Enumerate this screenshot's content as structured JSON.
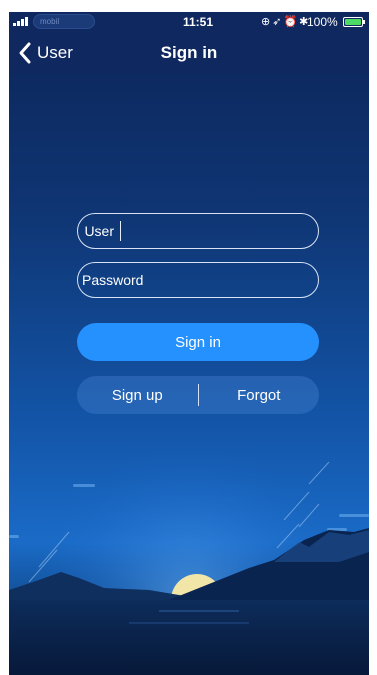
{
  "status_bar": {
    "carrier": "mobil",
    "time": "11:51",
    "battery_percent": "100%",
    "battery_level": 1.0,
    "icons": [
      "location-icon",
      "alarm-icon",
      "bluetooth-icon"
    ]
  },
  "nav": {
    "back_label": "User",
    "title": "Sign in"
  },
  "form": {
    "user_label": "User",
    "user_value": "",
    "password_label": "Password",
    "password_value": "",
    "sign_in_label": "Sign in",
    "sign_up_label": "Sign up",
    "forgot_label": "Forgot"
  },
  "colors": {
    "nav_background": "#102860",
    "primary_button": "#2591ff",
    "battery_green": "#4cd964"
  }
}
